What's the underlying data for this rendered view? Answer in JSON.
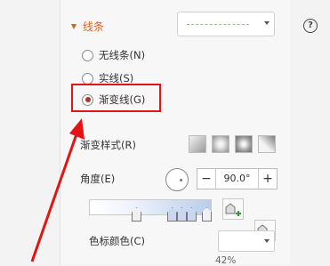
{
  "section": {
    "title": "线条"
  },
  "radios": [
    {
      "label": "无线条(N)",
      "checked": false
    },
    {
      "label": "实线(S)",
      "checked": false
    },
    {
      "label": "渐变线(G)",
      "checked": true
    }
  ],
  "gradient": {
    "style_label": "渐变样式(R)",
    "angle_label": "角度(E)",
    "angle_value": "90.0°",
    "minus": "−",
    "plus": "+",
    "stop_color_label": "色标颜色(C)",
    "bottom_value": "42%"
  },
  "help_icon": "?",
  "colors": {
    "accent": "#e0601b",
    "highlight": "#e21414",
    "radio_dot": "#b0302a"
  }
}
